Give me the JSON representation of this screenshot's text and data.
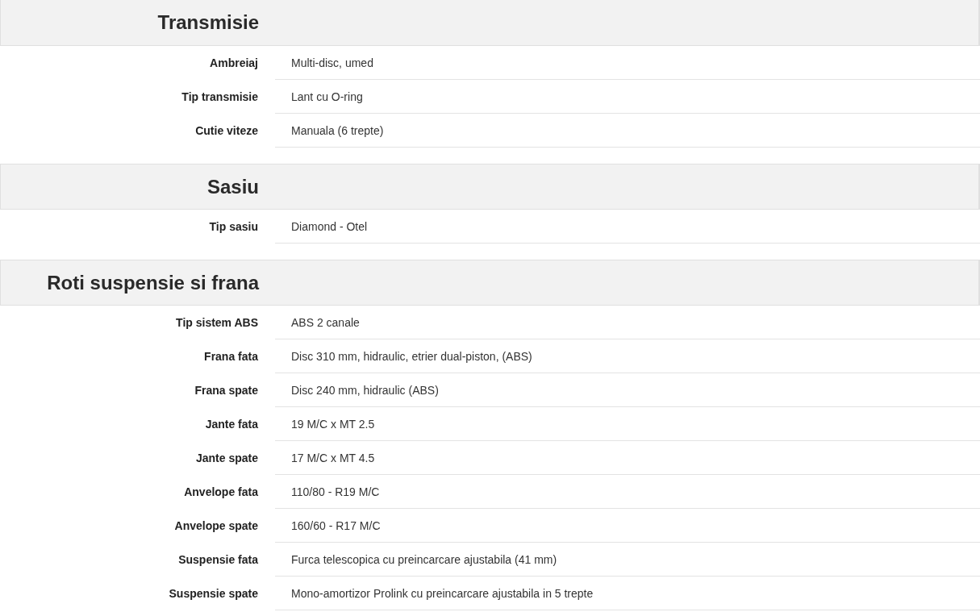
{
  "sections": [
    {
      "title": "Transmisie",
      "rows": [
        {
          "label": "Ambreiaj",
          "value": "Multi-disc, umed"
        },
        {
          "label": "Tip transmisie",
          "value": "Lant cu O-ring"
        },
        {
          "label": "Cutie viteze",
          "value": "Manuala (6 trepte)"
        }
      ]
    },
    {
      "title": "Sasiu",
      "rows": [
        {
          "label": "Tip sasiu",
          "value": "Diamond - Otel"
        }
      ]
    },
    {
      "title": "Roti suspensie si frana",
      "rows": [
        {
          "label": "Tip sistem ABS",
          "value": "ABS 2 canale"
        },
        {
          "label": "Frana fata",
          "value": "Disc 310 mm, hidraulic, etrier dual-piston, (ABS)"
        },
        {
          "label": "Frana spate",
          "value": "Disc 240 mm, hidraulic (ABS)"
        },
        {
          "label": "Jante fata",
          "value": "19 M/C x MT 2.5"
        },
        {
          "label": "Jante spate",
          "value": "17 M/C x MT 4.5"
        },
        {
          "label": "Anvelope fata",
          "value": "110/80 - R19 M/C"
        },
        {
          "label": "Anvelope spate",
          "value": "160/60 - R17 M/C"
        },
        {
          "label": "Suspensie fata",
          "value": "Furca telescopica cu preincarcare ajustabila (41 mm)"
        },
        {
          "label": "Suspensie spate",
          "value": "Mono-amortizor Prolink cu preincarcare ajustabila in 5 trepte"
        }
      ]
    }
  ]
}
